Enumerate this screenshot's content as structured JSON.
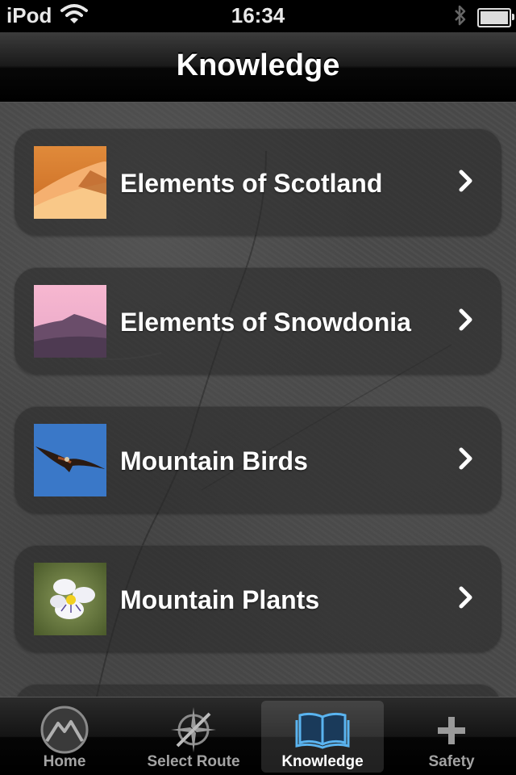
{
  "status_bar": {
    "carrier": "iPod",
    "time": "16:34"
  },
  "nav": {
    "title": "Knowledge"
  },
  "menu": [
    {
      "label": "Elements of Scotland",
      "icon": "snowy-mountain-thumbnail"
    },
    {
      "label": "Elements of Snowdonia",
      "icon": "pink-sky-mountain-thumbnail"
    },
    {
      "label": "Mountain Birds",
      "icon": "red-kite-thumbnail"
    },
    {
      "label": "Mountain Plants",
      "icon": "white-flower-thumbnail"
    }
  ],
  "tab_bar": {
    "tabs": [
      {
        "label": "Home",
        "icon": "mountain-circle-icon",
        "selected": false
      },
      {
        "label": "Select Route",
        "icon": "compass-icon",
        "selected": false
      },
      {
        "label": "Knowledge",
        "icon": "book-icon",
        "selected": true
      },
      {
        "label": "Safety",
        "icon": "plus-icon",
        "selected": false
      }
    ]
  },
  "colors": {
    "selected_tab_icon": "#5ab4f0",
    "tab_label_inactive": "#a3a3a3"
  }
}
